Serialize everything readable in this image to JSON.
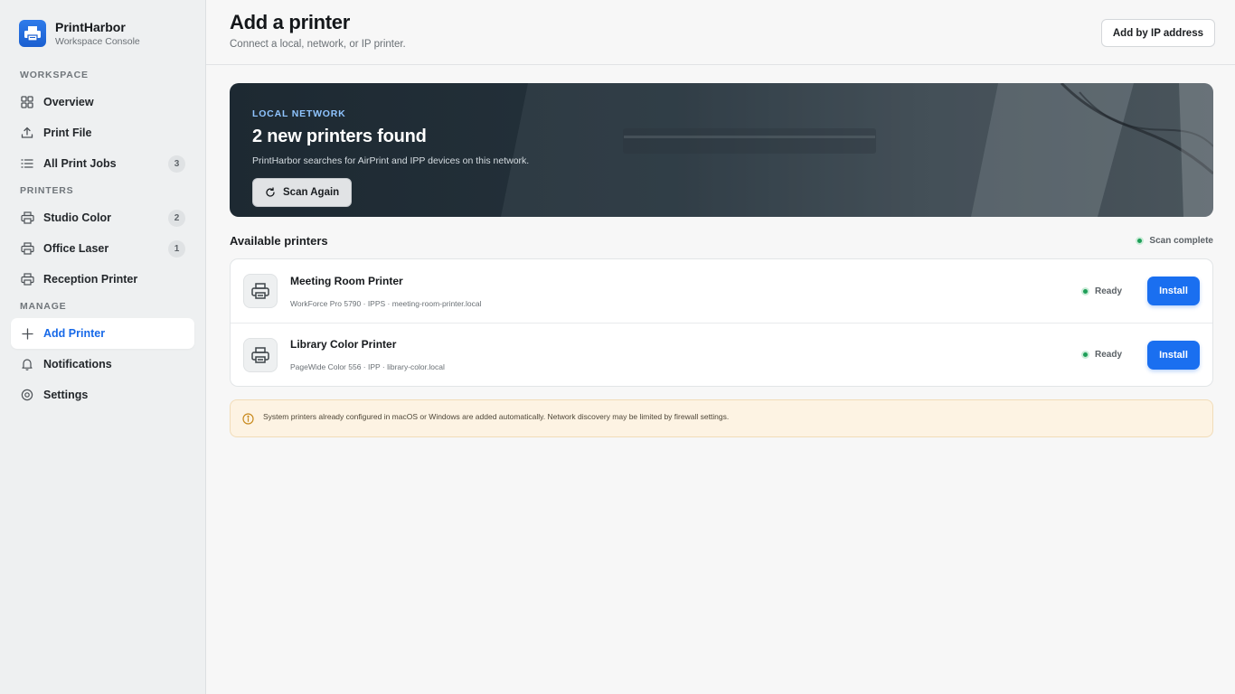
{
  "brand": {
    "name": "PrintHarbor",
    "subtitle": "Workspace Console"
  },
  "sidebar": {
    "sections": [
      {
        "label": "WORKSPACE",
        "items": [
          {
            "label": "Overview",
            "icon": "grid-icon"
          },
          {
            "label": "Print File",
            "icon": "upload-icon"
          },
          {
            "label": "All Print Jobs",
            "icon": "list-icon",
            "count": "3"
          }
        ]
      },
      {
        "label": "PRINTERS",
        "items": [
          {
            "label": "Studio Color",
            "icon": "printer-icon",
            "count": "2"
          },
          {
            "label": "Office Laser",
            "icon": "printer-icon",
            "count": "1"
          },
          {
            "label": "Reception Printer",
            "icon": "printer-icon"
          }
        ]
      },
      {
        "label": "MANAGE",
        "items": [
          {
            "label": "Add Printer",
            "icon": "plus-icon",
            "active": true
          },
          {
            "label": "Notifications",
            "icon": "bell-icon"
          },
          {
            "label": "Settings",
            "icon": "gear-icon"
          }
        ]
      }
    ]
  },
  "header": {
    "title": "Add a printer",
    "subtitle": "Connect a local, network, or IP printer.",
    "ip_button": "Add by IP address"
  },
  "hero": {
    "eyebrow": "LOCAL NETWORK",
    "title": "2 new printers found",
    "description": "PrintHarbor searches for AirPrint and IPP devices on this network.",
    "scan_button": "Scan Again"
  },
  "list": {
    "title": "Available printers",
    "status": "Scan complete",
    "printers": [
      {
        "name": "Meeting Room Printer",
        "meta": "WorkForce Pro 5790 · IPPS · meeting-room-printer.local",
        "status": "Ready",
        "action": "Install"
      },
      {
        "name": "Library Color Printer",
        "meta": "PageWide Color 556 · IPP · library-color.local",
        "status": "Ready",
        "action": "Install"
      }
    ]
  },
  "notice": {
    "text": "System printers already configured in macOS or Windows are added automatically. Network discovery may be limited by firewall settings."
  },
  "colors": {
    "accent": "#1a6ff0",
    "ready": "#1e9e58",
    "notice_bg": "#fdf3e3",
    "hero_eyebrow": "#8fc4ff"
  }
}
